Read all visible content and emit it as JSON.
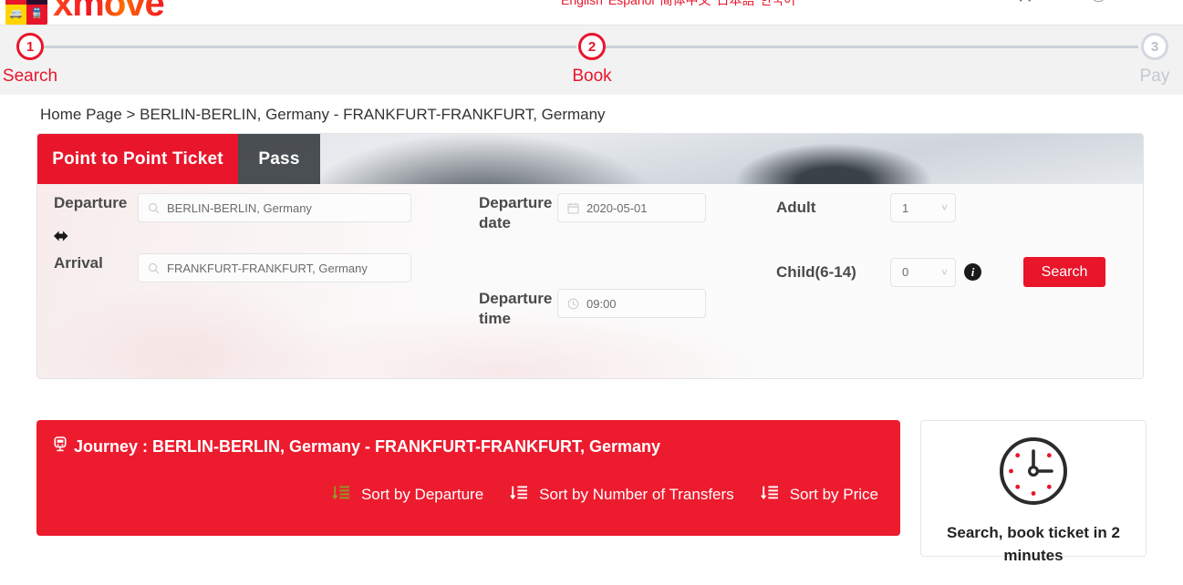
{
  "brand": {
    "logo_text": "xmove",
    "logo_tiles": [
      "bus-icon",
      "ship-icon",
      "car-icon",
      "train-icon"
    ],
    "accent_red": "#e8152b",
    "journey_red": "#ed1b2e"
  },
  "header": {
    "languages": [
      "English",
      "Espanol",
      "简体中文",
      "日本語",
      "한국어"
    ],
    "icons": [
      "cart-icon",
      "user-icon",
      "menu-icon"
    ]
  },
  "stepper": {
    "steps": [
      {
        "number": "1",
        "label": "Search",
        "state": "active"
      },
      {
        "number": "2",
        "label": "Book",
        "state": "active"
      },
      {
        "number": "3",
        "label": "Pay",
        "state": "inactive"
      }
    ]
  },
  "breadcrumb": {
    "text": "Home Page > BERLIN-BERLIN, Germany - FRANKFURT-FRANKFURT, Germany"
  },
  "search_panel": {
    "tabs": [
      {
        "label": "Point to Point Ticket",
        "active": true
      },
      {
        "label": "Pass",
        "active": false
      }
    ],
    "fields": {
      "departure_label": "Departure",
      "departure_value": "BERLIN-BERLIN, Germany",
      "arrival_label": "Arrival",
      "arrival_value": "FRANKFURT-FRANKFURT, Germany",
      "departure_date_label": "Departure date",
      "departure_date_value": "2020-05-01",
      "departure_time_label": "Departure time",
      "departure_time_value": "09:00",
      "adult_label": "Adult",
      "adult_value": "1",
      "child_label": "Child(6-14)",
      "child_value": "0",
      "search_button": "Search"
    }
  },
  "results": {
    "journey_title": "Journey : BERLIN-BERLIN, Germany - FRANKFURT-FRANKFURT, Germany",
    "sorts": [
      {
        "label": "Sort by Departure",
        "active": true
      },
      {
        "label": "Sort by Number of Transfers",
        "active": false
      },
      {
        "label": "Sort by Price",
        "active": false
      }
    ]
  },
  "promo": {
    "text": "Search, book ticket in 2 minutes"
  }
}
